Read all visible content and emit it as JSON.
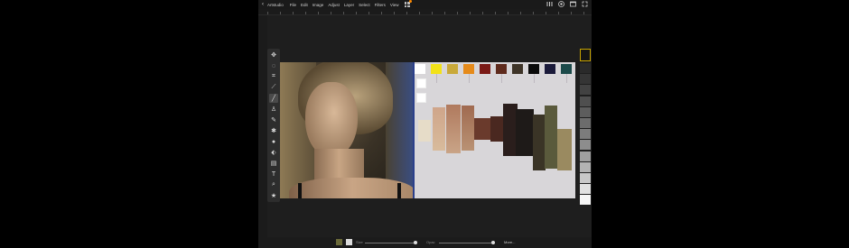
{
  "menubar": {
    "back_symbol": "‹",
    "app_name": "Artstudio",
    "menus": [
      "File",
      "Edit",
      "Image",
      "Adjust",
      "Layer",
      "Select",
      "Filters",
      "View"
    ],
    "right_icons": [
      "brush-settings-icon",
      "layers-icon",
      "window-icon",
      "fullscreen-icon"
    ]
  },
  "tools": [
    "move-icon",
    "lasso-icon",
    "crop-icon",
    "eyedropper-icon",
    "brush-icon",
    "stamp-icon",
    "smudge-icon",
    "blur-icon",
    "burn-icon",
    "bucket-icon",
    "gradient-icon",
    "text-icon",
    "zoom-icon",
    "star-icon"
  ],
  "tool_glyphs": [
    "✥",
    "◌",
    "⌗",
    "⟋",
    "╱",
    "♙",
    "✎",
    "✱",
    "●",
    "⬖",
    "▤",
    "T",
    "⌕",
    "★"
  ],
  "active_tool_index": 4,
  "palette_swatches": [
    "#ffffff",
    "#f2e218",
    "#c9a93a",
    "#e58a1a",
    "#7a1a16",
    "#5e2a1c",
    "#3e3428",
    "#0a0a0a",
    "#1a1a3a",
    "#1c4a4a"
  ],
  "right_palette": [
    "#2a2a2a",
    "#353535",
    "#424242",
    "#4f4f4f",
    "#5d5d5d",
    "#6c6c6c",
    "#7c7c7c",
    "#8d8d8d",
    "#9f9f9f",
    "#b3b3b3",
    "#c8c8c8",
    "#e0e0e0",
    "#f5f5f5"
  ],
  "bottombar": {
    "size_label": "Size",
    "opacity_label": "Opac",
    "more_label": "More..."
  }
}
